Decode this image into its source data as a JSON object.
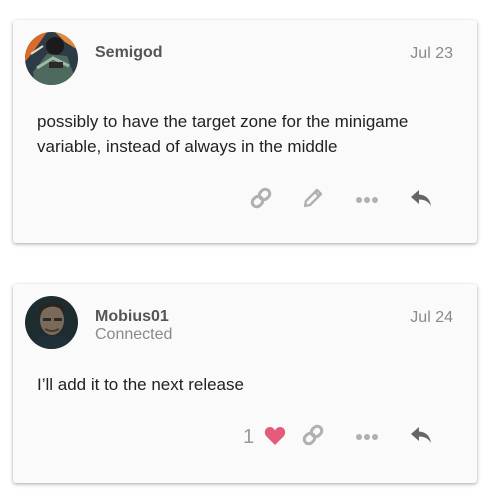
{
  "posts": [
    {
      "username": "Semigod",
      "user_title": "",
      "date": "Jul 23",
      "body": "possibly to have the target zone for the minigame variable, instead of always in the middle",
      "actions": [
        "link-icon",
        "pencil-icon",
        "more-icon",
        "reply-icon"
      ]
    },
    {
      "username": "Mobius01",
      "user_title": "Connected",
      "date": "Jul 24",
      "body": "I’ll add it to the next release",
      "like_count": "1",
      "actions": [
        "heart-icon",
        "link-icon",
        "more-icon",
        "reply-icon"
      ]
    }
  ],
  "colors": {
    "card_bg": "#fafafa",
    "icon_gray": "#b0b0b0",
    "reply_gray": "#666666",
    "heart_pink": "#e45a7a"
  }
}
